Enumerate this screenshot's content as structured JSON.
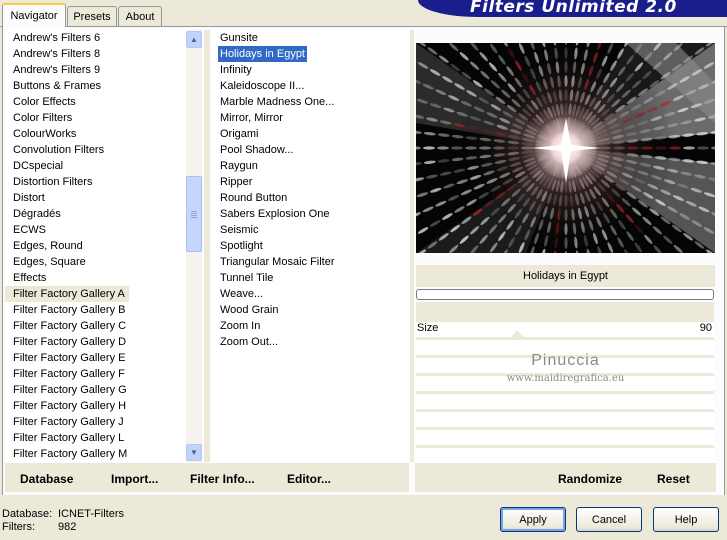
{
  "tabs": [
    {
      "label": "Navigator",
      "active": true
    },
    {
      "label": "Presets",
      "active": false
    },
    {
      "label": "About",
      "active": false
    }
  ],
  "banner": "Filters Unlimited 2.0",
  "categories": {
    "items": [
      "Andrew's Filters 6",
      "Andrew's Filters 8",
      "Andrew's Filters 9",
      "Buttons & Frames",
      "Color Effects",
      "Color Filters",
      "ColourWorks",
      "Convolution Filters",
      "DCspecial",
      "Distortion Filters",
      "Distort",
      "Dégradés",
      "ECWS",
      "Edges, Round",
      "Edges, Square",
      "Effects",
      "Filter Factory Gallery A",
      "Filter Factory Gallery B",
      "Filter Factory Gallery C",
      "Filter Factory Gallery D",
      "Filter Factory Gallery E",
      "Filter Factory Gallery F",
      "Filter Factory Gallery G",
      "Filter Factory Gallery H",
      "Filter Factory Gallery J",
      "Filter Factory Gallery L",
      "Filter Factory Gallery M"
    ],
    "selected": "Filter Factory Gallery A"
  },
  "filters": {
    "items": [
      "Gunsite",
      "Holidays in Egypt",
      "Infinity",
      "Kaleidoscope II...",
      "Marble Madness One...",
      "Mirror, Mirror",
      "Origami",
      "Pool Shadow...",
      "Raygun",
      "Ripper",
      "Round Button",
      "Sabers Explosion One",
      "Seismic",
      "Spotlight",
      "Triangular Mosaic Filter",
      "Tunnel Tile",
      "Weave...",
      "Wood Grain",
      "Zoom In",
      "Zoom Out..."
    ],
    "selected": "Holidays in Egypt"
  },
  "preview": {
    "filter_name": "Holidays in Egypt",
    "progress": 0,
    "param_label": "Size",
    "param_value": "90",
    "watermark_name": "Pinuccia",
    "watermark_url": "www.maidiregrafica.eu"
  },
  "bottom_links": {
    "database": "Database",
    "import": "Import...",
    "filter_info": "Filter Info...",
    "editor": "Editor...",
    "randomize": "Randomize",
    "reset": "Reset"
  },
  "status": {
    "database_label": "Database:",
    "database_value": "ICNET-Filters",
    "filters_label": "Filters:",
    "filters_value": "982"
  },
  "buttons": {
    "apply": "Apply",
    "cancel": "Cancel",
    "help": "Help"
  }
}
